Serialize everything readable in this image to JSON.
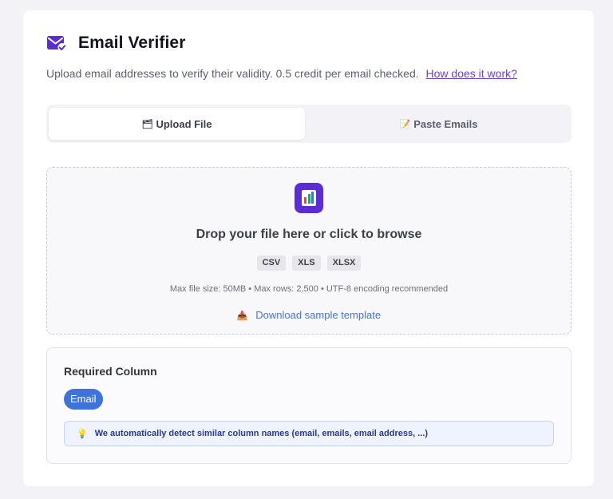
{
  "header": {
    "title": "Email Verifier",
    "icon": "email-check-icon",
    "subtitle": "Upload email addresses to verify their validity. 0.5 credit per email checked.",
    "help_link": "How does it work?"
  },
  "tabs": [
    {
      "label": "Upload File",
      "icon": "folder-icon",
      "glyph": "🗂",
      "active": true
    },
    {
      "label": "Paste Emails",
      "icon": "memo-icon",
      "glyph": "📝",
      "active": false
    }
  ],
  "dropzone": {
    "icon": "bar-chart-icon",
    "title": "Drop your file here or click to browse",
    "formats": [
      "CSV",
      "XLS",
      "XLSX"
    ],
    "limits": "Max file size: 50MB • Max rows: 2,500 • UTF-8 encoding recommended",
    "download_label": "Download sample template",
    "download_glyph": "📥"
  },
  "required": {
    "title": "Required Column",
    "column": "Email",
    "hint_glyph": "💡",
    "hint": "We automatically detect similar column names (email, emails, email address, ...)"
  },
  "colors": {
    "accent": "#5b2bd6",
    "link": "#6b3fd6",
    "pill": "#3e73db"
  }
}
